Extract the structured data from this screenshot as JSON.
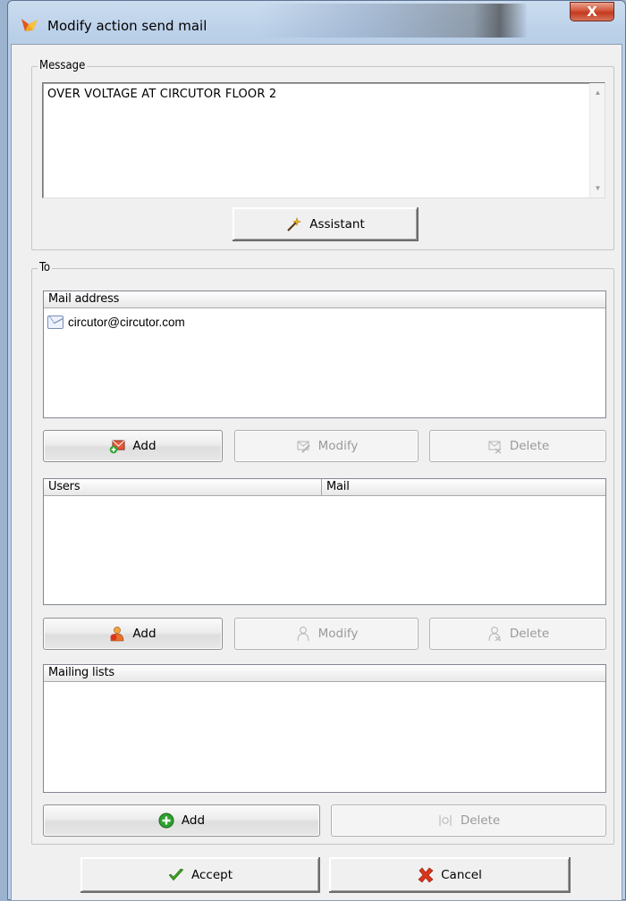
{
  "window": {
    "title": "Modify action send mail",
    "close_label": "X"
  },
  "message": {
    "legend": "Message",
    "text": "OVER VOLTAGE AT CIRCUTOR FLOOR 2",
    "assistant_button": "Assistant"
  },
  "to": {
    "legend": "To",
    "mail_address": {
      "column": "Mail address",
      "rows": [
        "circutor@circutor.com"
      ],
      "add": "Add",
      "modify": "Modify",
      "delete": "Delete"
    },
    "users": {
      "columns": [
        "Users",
        "Mail"
      ],
      "add": "Add",
      "modify": "Modify",
      "delete": "Delete"
    },
    "mailing_lists": {
      "column": "Mailing lists",
      "add": "Add",
      "delete": "Delete"
    }
  },
  "footer": {
    "accept": "Accept",
    "cancel": "Cancel"
  },
  "colors": {
    "accept_check": "#3a9a1c",
    "cancel_x": "#d9351c",
    "add_green": "#2ea12e"
  }
}
